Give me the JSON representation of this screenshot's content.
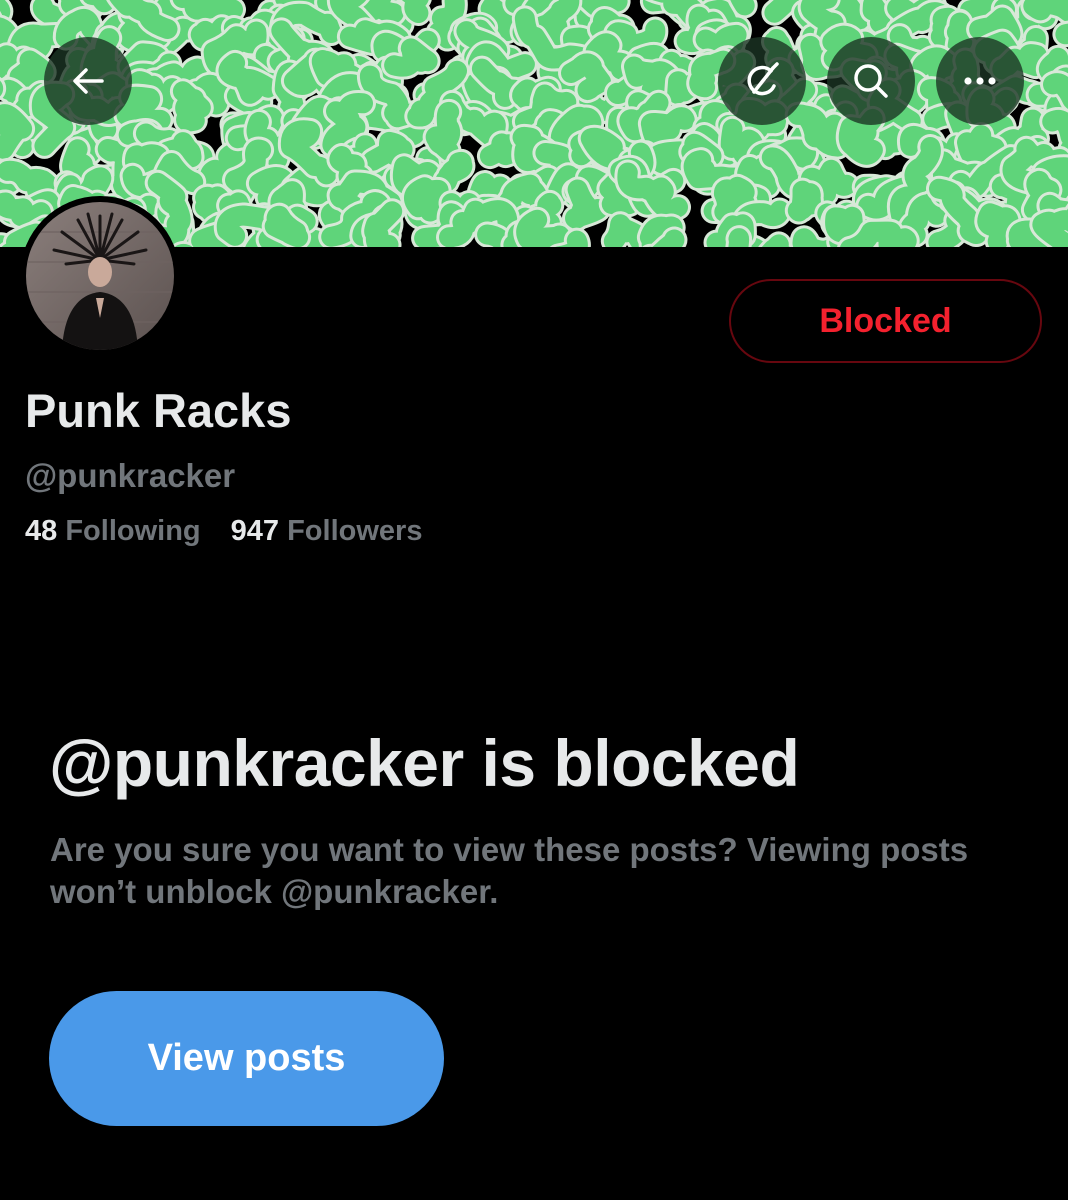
{
  "header": {
    "back_icon": "arrow-left-icon",
    "grok_icon": "grok-icon",
    "search_icon": "search-icon",
    "more_icon": "more-horizontal-icon"
  },
  "profile": {
    "display_name": "Punk Racks",
    "handle": "@punkracker",
    "following_count": "48",
    "following_label": "Following",
    "followers_count": "947",
    "followers_label": "Followers",
    "relationship_button_label": "Blocked"
  },
  "blocked_notice": {
    "title": "@punkracker is blocked",
    "description": "Are you sure you want to view these posts? Viewing posts won’t unblock @punkracker.",
    "view_button_label": "View posts"
  },
  "colors": {
    "background": "#000000",
    "banner_green": "#5fd47a",
    "blocked_red": "#f4212e",
    "primary_blue": "#4a99e9",
    "secondary_text": "#71767b"
  }
}
